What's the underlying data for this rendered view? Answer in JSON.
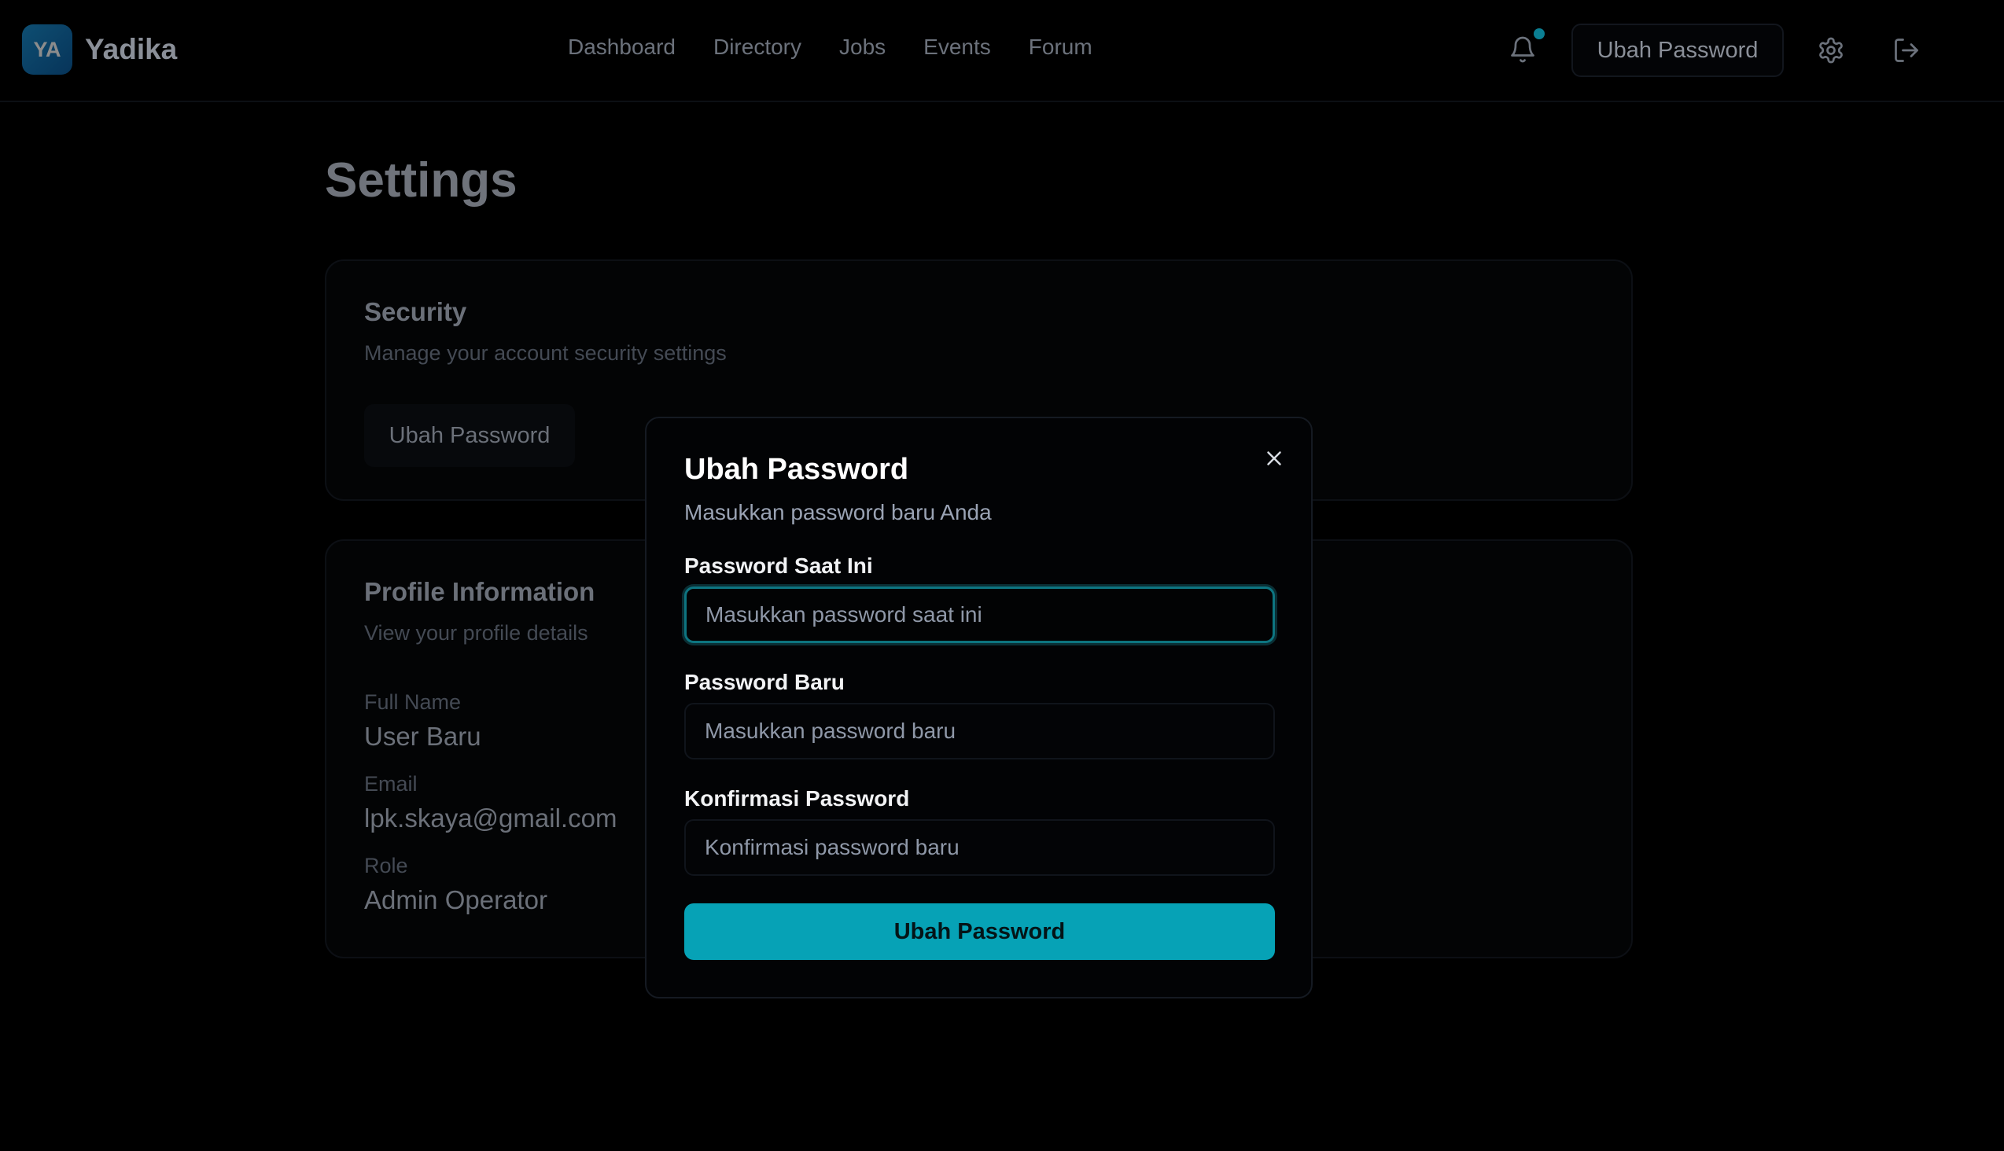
{
  "brand": {
    "logo_text": "YA",
    "name": "Yadika"
  },
  "nav": {
    "items": [
      {
        "label": "Dashboard"
      },
      {
        "label": "Directory"
      },
      {
        "label": "Jobs"
      },
      {
        "label": "Events"
      },
      {
        "label": "Forum"
      }
    ]
  },
  "topbar": {
    "change_password_label": "Ubah Password"
  },
  "page": {
    "title": "Settings"
  },
  "security": {
    "title": "Security",
    "subtitle": "Manage your account security settings",
    "button_label": "Ubah Password"
  },
  "profile": {
    "title": "Profile Information",
    "subtitle": "View your profile details",
    "full_name_label": "Full Name",
    "full_name_value": "User Baru",
    "email_label": "Email",
    "email_value": "lpk.skaya@gmail.com",
    "role_label": "Role",
    "role_value": "Admin Operator"
  },
  "modal": {
    "title": "Ubah Password",
    "subtitle": "Masukkan password baru Anda",
    "current_label": "Password Saat Ini",
    "current_placeholder": "Masukkan password saat ini",
    "new_label": "Password Baru",
    "new_placeholder": "Masukkan password baru",
    "confirm_label": "Konfirmasi Password",
    "confirm_placeholder": "Konfirmasi password baru",
    "submit_label": "Ubah Password"
  },
  "icons": {
    "bell": "bell-icon",
    "gear": "gear-icon",
    "logout": "logout-icon",
    "close": "close-icon"
  },
  "colors": {
    "accent": "#06a2b6",
    "notification_dot": "#0b7f93",
    "background": "#000000"
  }
}
